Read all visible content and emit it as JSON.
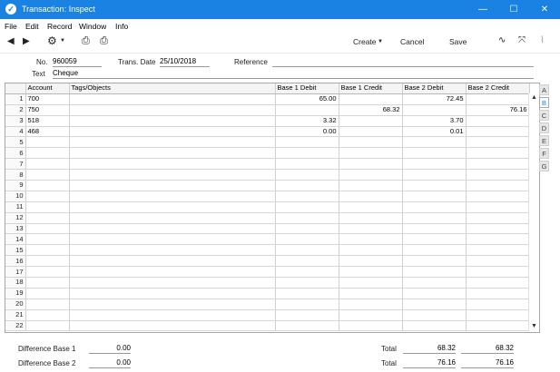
{
  "window": {
    "title": "Transaction: Inspect"
  },
  "menu": [
    "File",
    "Edit",
    "Record",
    "Window",
    "Info"
  ],
  "toolbar": {
    "create_label": "Create",
    "cancel_label": "Cancel",
    "save_label": "Save"
  },
  "header": {
    "no_label": "No.",
    "no_value": "960059",
    "date_label": "Trans. Date",
    "date_value": "25/10/2018",
    "ref_label": "Reference",
    "ref_value": "",
    "text_label": "Text",
    "text_value": "Cheque"
  },
  "grid": {
    "columns": [
      "Account",
      "Tags/Objects",
      "Base 1 Debit",
      "Base 1 Credit",
      "Base 2 Debit",
      "Base 2 Credit"
    ],
    "rows": [
      [
        "700",
        "",
        "65.00",
        "",
        "72.45",
        ""
      ],
      [
        "750",
        "",
        "",
        "68.32",
        "",
        "76.16"
      ],
      [
        "518",
        "",
        "3.32",
        "",
        "3.70",
        ""
      ],
      [
        "468",
        "",
        "0.00",
        "",
        "0.01",
        ""
      ]
    ],
    "row_count": 22
  },
  "tabs": [
    "A",
    "B",
    "C",
    "D",
    "E",
    "F",
    "G"
  ],
  "active_tab": "B",
  "footer": {
    "diff1_label": "Difference Base 1",
    "diff1_value": "0.00",
    "diff2_label": "Difference Base 2",
    "diff2_value": "0.00",
    "total_label": "Total",
    "total1_debit": "68.32",
    "total1_credit": "68.32",
    "total2_debit": "76.16",
    "total2_credit": "76.16"
  }
}
